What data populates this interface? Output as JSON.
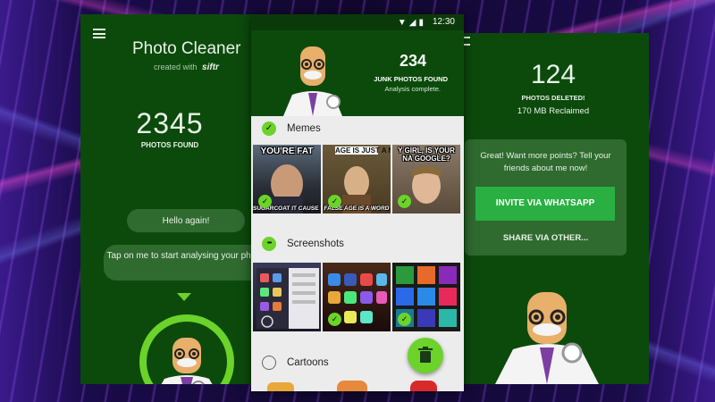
{
  "left_screen": {
    "app_title": "Photo Cleaner",
    "created_with": "created with",
    "brand_logo": "siftr",
    "photos_count": "2345",
    "photos_label": "PHOTOS FOUND",
    "hello_bubble": "Hello again!",
    "tap_bubble": "Tap on me to start analysing your photos."
  },
  "mid_screen": {
    "status_time": "12:30",
    "junk_count": "234",
    "junk_label": "JUNK PHOTOS FOUND",
    "junk_sub": "Analysis complete.",
    "sections": [
      {
        "label": "Memes",
        "state": "checked"
      },
      {
        "label": "Screenshots",
        "state": "partial"
      },
      {
        "label": "Cartoons",
        "state": "unchecked"
      }
    ],
    "memes": [
      {
        "top": "YOU'RE FAT",
        "bottom": "SUGARCOAT IT CAUSE YOU'LL EAT THAT TOO"
      },
      {
        "top": "AGE IS JUST A NUMBER",
        "bottom": "FALSE AGE IS A WORD"
      },
      {
        "top": "Y GIRL, IS YOUR NA GOOGLE?",
        "bottom": ""
      }
    ],
    "partial_symbol": "•••",
    "check_symbol": "✓",
    "accent": "#6bd32a",
    "header_bg": "#0c4a0c"
  },
  "right_screen": {
    "deleted_count": "124",
    "deleted_label": "PHOTOS DELETED!",
    "reclaimed": "170 MB Reclaimed",
    "invite_text": "Great! Want more points? Tell your friends about me now!",
    "whatsapp_button": "INVITE VIA WHATSAPP",
    "share_other": "SHARE VIA OTHER..."
  }
}
